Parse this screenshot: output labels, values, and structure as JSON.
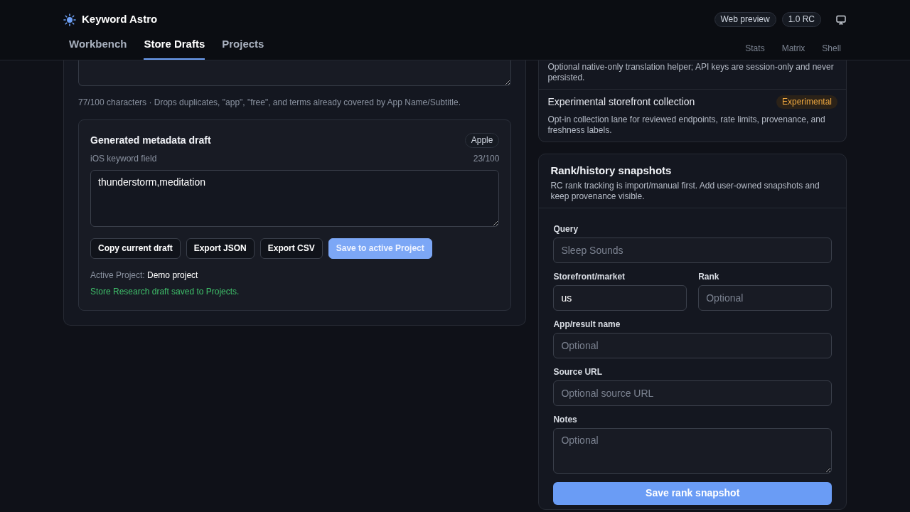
{
  "app": {
    "title": "Keyword Astro",
    "badges": [
      "Web preview",
      "1.0 RC"
    ]
  },
  "tabs": [
    {
      "label": "Workbench",
      "selected": false
    },
    {
      "label": "Store Drafts",
      "selected": true
    },
    {
      "label": "Projects",
      "selected": false
    }
  ],
  "secondary_links": [
    "Stats",
    "Matrix",
    "Shell"
  ],
  "keywords_section": {
    "help": "77/100 characters · Drops duplicates, \"app\", \"free\", and terms already covered by App Name/Subtitle.",
    "draft": {
      "title": "Generated metadata draft",
      "badge": "Apple",
      "field_label": "iOS keyword field",
      "count": "23/100",
      "value": "thunderstorm,meditation",
      "buttons": [
        {
          "label": "Copy current draft",
          "kind": "outline"
        },
        {
          "label": "Export JSON",
          "kind": "outline"
        },
        {
          "label": "Export CSV",
          "kind": "outline"
        },
        {
          "label": "Save to active Project",
          "kind": "primary"
        }
      ],
      "active_project_label": "Active Project:",
      "active_project": "Demo project",
      "status": "Store Research draft saved to Projects."
    }
  },
  "features": [
    {
      "description": "Optional native-only translation helper; API keys are session-only and never persisted."
    },
    {
      "title": "Experimental storefront collection",
      "badge": "Experimental",
      "description": "Opt-in collection lane for reviewed endpoints, rate limits, provenance, and freshness labels."
    }
  ],
  "rank_form": {
    "title": "Rank/history snapshots",
    "description": "RC rank tracking is import/manual first. Add user-owned snapshots and keep provenance visible.",
    "field_rows": [
      [
        {
          "label": "Query",
          "placeholder": "Sleep Sounds",
          "kind": "input"
        }
      ],
      [
        {
          "label": "Storefront/market",
          "value": "us",
          "kind": "input"
        },
        {
          "label": "Rank",
          "placeholder": "Optional",
          "kind": "input"
        }
      ],
      [
        {
          "label": "App/result name",
          "placeholder": "Optional",
          "kind": "input"
        }
      ],
      [
        {
          "label": "Source URL",
          "placeholder": "Optional source URL",
          "kind": "input"
        }
      ],
      [
        {
          "label": "Notes",
          "placeholder": "Optional",
          "kind": "textarea"
        }
      ]
    ],
    "submit": "Save rank snapshot"
  }
}
